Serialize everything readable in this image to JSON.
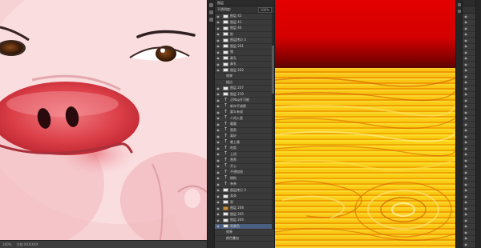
{
  "left_status": {
    "zoom": "100%",
    "doc": "文档:XXX/XXX"
  },
  "panel1": {
    "tab": "图层",
    "blend_label": "不透明度:",
    "opacity": "100%",
    "fill_label": "填充:",
    "fill": "100%",
    "layers": [
      {
        "name": "图层 42",
        "type": "img"
      },
      {
        "name": "图层 41",
        "type": "img"
      },
      {
        "name": "图层 40",
        "type": "img"
      },
      {
        "name": "脸",
        "type": "img"
      },
      {
        "name": "图层拷贝 3",
        "type": "img"
      },
      {
        "name": "图层 201",
        "type": "img"
      },
      {
        "name": "猪",
        "type": "img"
      },
      {
        "name": "鼻孔",
        "type": "img"
      },
      {
        "name": "鼻孔",
        "type": "img"
      },
      {
        "name": "图层 202",
        "type": "img"
      },
      {
        "name": "效果",
        "type": "fx"
      },
      {
        "name": "描边",
        "type": "fx"
      },
      {
        "name": "图层 207",
        "type": "img"
      },
      {
        "name": "图层 219",
        "type": "img"
      },
      {
        "name": "正Nap开可能",
        "type": "txt"
      },
      {
        "name": "新年不减肥",
        "type": "txt"
      },
      {
        "name": "要么有成",
        "type": "txt"
      },
      {
        "name": "人间入夏",
        "type": "txt"
      },
      {
        "name": "暖暖",
        "type": "txt"
      },
      {
        "name": "营养",
        "type": "txt"
      },
      {
        "name": "真好",
        "type": "txt"
      },
      {
        "name": "晚上睡",
        "type": "txt"
      },
      {
        "name": "吃饭",
        "type": "txt"
      },
      {
        "name": "上班",
        "type": "txt"
      },
      {
        "name": "营养",
        "type": "txt"
      },
      {
        "name": "开心",
        "type": "txt"
      },
      {
        "name": "不想加班",
        "type": "txt"
      },
      {
        "name": "拥抱",
        "type": "txt"
      },
      {
        "name": "亲亲",
        "type": "txt"
      },
      {
        "name": "图层拷贝 3",
        "type": "img"
      },
      {
        "name": "耳朵",
        "type": "img"
      },
      {
        "name": "背",
        "type": "img"
      },
      {
        "name": "图层 208",
        "type": "folder"
      },
      {
        "name": "图层 205",
        "type": "img"
      },
      {
        "name": "图层 204",
        "type": "img"
      },
      {
        "name": "背景色",
        "type": "img",
        "selected": true
      },
      {
        "name": "效果",
        "type": "fx"
      },
      {
        "name": "颜色叠加",
        "type": "fx"
      }
    ]
  },
  "panel2": {
    "layers_count": 40
  },
  "icons": [
    "eye-icon",
    "text-layer-icon",
    "folder-icon",
    "layer-thumbnail-icon"
  ]
}
